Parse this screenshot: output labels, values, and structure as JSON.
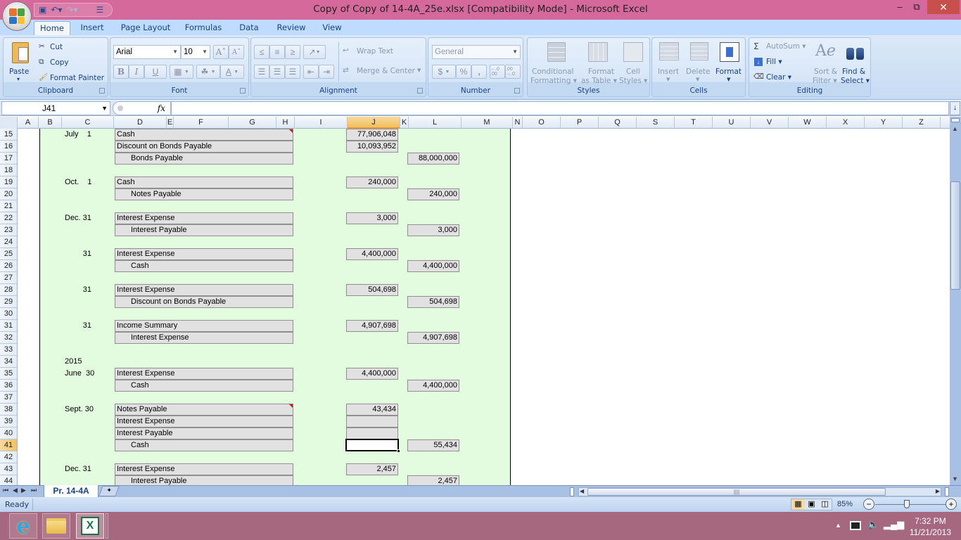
{
  "window": {
    "title": "Copy of Copy of 14-4A_25e.xlsx  [Compatibility Mode]  -  Microsoft Excel",
    "minimize": "–",
    "restore": "⧉",
    "close": "✕"
  },
  "quick_access": {
    "save_icon": "💾",
    "undo_icon": "↶",
    "redo_icon": "↷",
    "customize_icon": "▾"
  },
  "tabs": [
    {
      "label": "Home",
      "active": true
    },
    {
      "label": "Insert"
    },
    {
      "label": "Page Layout"
    },
    {
      "label": "Formulas"
    },
    {
      "label": "Data"
    },
    {
      "label": "Review"
    },
    {
      "label": "View"
    }
  ],
  "ribbon": {
    "clipboard": {
      "label": "Clipboard",
      "paste": "Paste",
      "cut": "Cut",
      "copy": "Copy",
      "format_painter": "Format Painter"
    },
    "font": {
      "label": "Font",
      "font_name": "Arial",
      "font_size": "10",
      "bold": "B",
      "italic": "I",
      "underline": "U",
      "grow": "A˄",
      "shrink": "A˅",
      "font_color": "A"
    },
    "alignment": {
      "label": "Alignment",
      "wrap_text": "Wrap Text",
      "merge_center": "Merge & Center"
    },
    "number": {
      "label": "Number",
      "format": "General",
      "currency": "$",
      "percent": "%",
      "comma": ",",
      "inc_decimal": "←.0 .00",
      "dec_decimal": ".00 →.0"
    },
    "styles": {
      "label": "Styles",
      "conditional_1": "Conditional",
      "conditional_2": "Formatting ▾",
      "format_table_1": "Format",
      "format_table_2": "as Table ▾",
      "cell_styles_1": "Cell",
      "cell_styles_2": "Styles ▾"
    },
    "cells": {
      "label": "Cells",
      "insert": "Insert",
      "delete": "Delete",
      "format": "Format"
    },
    "editing": {
      "label": "Editing",
      "autosum": "AutoSum ▾",
      "fill": "Fill ▾",
      "clear": "Clear ▾",
      "sort_1": "Sort &",
      "sort_2": "Filter ▾",
      "find_1": "Find &",
      "find_2": "Select ▾"
    }
  },
  "formula_bar": {
    "name_box": "J41",
    "fx": "fx",
    "formula": ""
  },
  "columns": [
    "A",
    "B",
    "C",
    "D",
    "E",
    "F",
    "G",
    "H",
    "I",
    "J",
    "K",
    "L",
    "M",
    "N",
    "O",
    "P",
    "Q",
    "S",
    "T",
    "U",
    "V",
    "W",
    "X",
    "Y",
    "Z"
  ],
  "selected_column": "J",
  "selected_row": "41",
  "rows": [
    "15",
    "16",
    "17",
    "18",
    "19",
    "20",
    "21",
    "22",
    "23",
    "24",
    "25",
    "26",
    "27",
    "28",
    "29",
    "30",
    "31",
    "32",
    "33",
    "34",
    "35",
    "36",
    "37",
    "38",
    "39",
    "40",
    "41",
    "42",
    "43",
    "44"
  ],
  "journal": [
    {
      "row": 0,
      "date": "July    1",
      "account": "Cash",
      "debit": "77,906,048",
      "comment": true
    },
    {
      "row": 1,
      "account": "Discount on Bonds Payable",
      "debit": "10,093,952"
    },
    {
      "row": 2,
      "account": "Bonds Payable",
      "indent": true,
      "credit": "88,000,000"
    },
    {
      "row": 4,
      "date": "Oct.    1",
      "account": "Cash",
      "debit": "240,000"
    },
    {
      "row": 5,
      "account": "Notes Payable",
      "indent": true,
      "credit": "240,000"
    },
    {
      "row": 7,
      "date": "Dec. 31",
      "account": "Interest Expense",
      "debit": "3,000"
    },
    {
      "row": 8,
      "account": "Interest Payable",
      "indent": true,
      "credit": "3,000"
    },
    {
      "row": 10,
      "date_r": "31",
      "account": "Interest Expense",
      "debit": "4,400,000"
    },
    {
      "row": 11,
      "account": "Cash",
      "indent": true,
      "credit": "4,400,000"
    },
    {
      "row": 13,
      "date_r": "31",
      "account": "Interest Expense",
      "debit": "504,698"
    },
    {
      "row": 14,
      "account": "Discount on Bonds Payable",
      "indent": true,
      "credit": "504,698"
    },
    {
      "row": 16,
      "date_r": "31",
      "account": "Income Summary",
      "debit": "4,907,698"
    },
    {
      "row": 17,
      "account": "Interest Expense",
      "indent": true,
      "credit": "4,907,698"
    },
    {
      "row": 19,
      "date": "2015"
    },
    {
      "row": 20,
      "date": "June  30",
      "account": "Interest Expense",
      "debit": "4,400,000"
    },
    {
      "row": 21,
      "account": "Cash",
      "indent": true,
      "credit": "4,400,000"
    },
    {
      "row": 23,
      "date": "Sept. 30",
      "account": "Notes Payable",
      "debit": "43,434",
      "comment": true
    },
    {
      "row": 24,
      "account": "Interest Expense",
      "debit": ""
    },
    {
      "row": 25,
      "account": "Interest Payable",
      "debit": ""
    },
    {
      "row": 26,
      "account": "Cash",
      "indent": true,
      "debit_selected": true,
      "credit": "55,434"
    },
    {
      "row": 28,
      "date": "Dec. 31",
      "account": "Interest Expense",
      "debit": "2,457"
    },
    {
      "row": 29,
      "account": "Interest Payable",
      "indent": true,
      "credit": "2,457"
    }
  ],
  "sheet_tabs": [
    {
      "label": "Pr. 14-4A",
      "active": true
    }
  ],
  "status": {
    "ready": "Ready",
    "zoom": "85%",
    "zoom_fraction": 0.45
  },
  "taskbar": {
    "time": "7:32 PM",
    "date": "11/21/2013",
    "apps": [
      "Internet Explorer",
      "File Explorer",
      "Microsoft Excel"
    ]
  },
  "colors": {
    "titlebar": "#d5699c",
    "ribbon": "#bfdbff",
    "sheet_fill": "#e3fbde",
    "entry_cell": "#e1e1e1",
    "taskbar": "#a5687f",
    "accent": "#15428b"
  }
}
